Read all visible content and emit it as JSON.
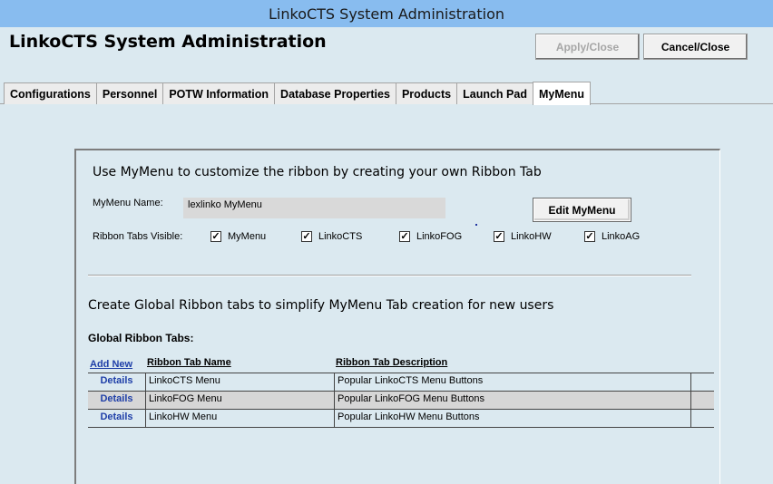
{
  "window": {
    "title": "LinkoCTS System Administration"
  },
  "header": {
    "app_title": "LinkoCTS System Administration",
    "apply_label": "Apply/Close",
    "cancel_label": "Cancel/Close"
  },
  "tabs": [
    {
      "label": "Configurations"
    },
    {
      "label": "Personnel"
    },
    {
      "label": "POTW Information"
    },
    {
      "label": "Database Properties"
    },
    {
      "label": "Products"
    },
    {
      "label": "Launch Pad"
    },
    {
      "label": "MyMenu",
      "active": true
    }
  ],
  "mymenu": {
    "heading": "Use MyMenu to customize the ribbon by creating your own Ribbon Tab",
    "name_label": "MyMenu Name:",
    "name_value": "lexlinko MyMenu",
    "edit_button": "Edit MyMenu",
    "ribbon_visible_label": "Ribbon Tabs Visible:",
    "checkboxes": [
      {
        "label": "MyMenu",
        "checked": true
      },
      {
        "label": "LinkoCTS",
        "checked": true
      },
      {
        "label": "LinkoFOG",
        "checked": true
      },
      {
        "label": "LinkoHW",
        "checked": true
      },
      {
        "label": "LinkoAG",
        "checked": true
      }
    ]
  },
  "global": {
    "heading": "Create Global Ribbon tabs to simplify MyMenu Tab creation for new users",
    "tabs_label": "Global Ribbon Tabs:",
    "add_new": "Add New",
    "col_name": "Ribbon Tab Name",
    "col_desc": "Ribbon Tab Description",
    "rows": [
      {
        "action": "Details",
        "name": "LinkoCTS Menu",
        "description": "Popular LinkoCTS Menu Buttons"
      },
      {
        "action": "Details",
        "name": "LinkoFOG Menu",
        "description": "Popular LinkoFOG Menu Buttons"
      },
      {
        "action": "Details",
        "name": "LinkoHW Menu",
        "description": "Popular LinkoHW Menu Buttons"
      }
    ]
  }
}
